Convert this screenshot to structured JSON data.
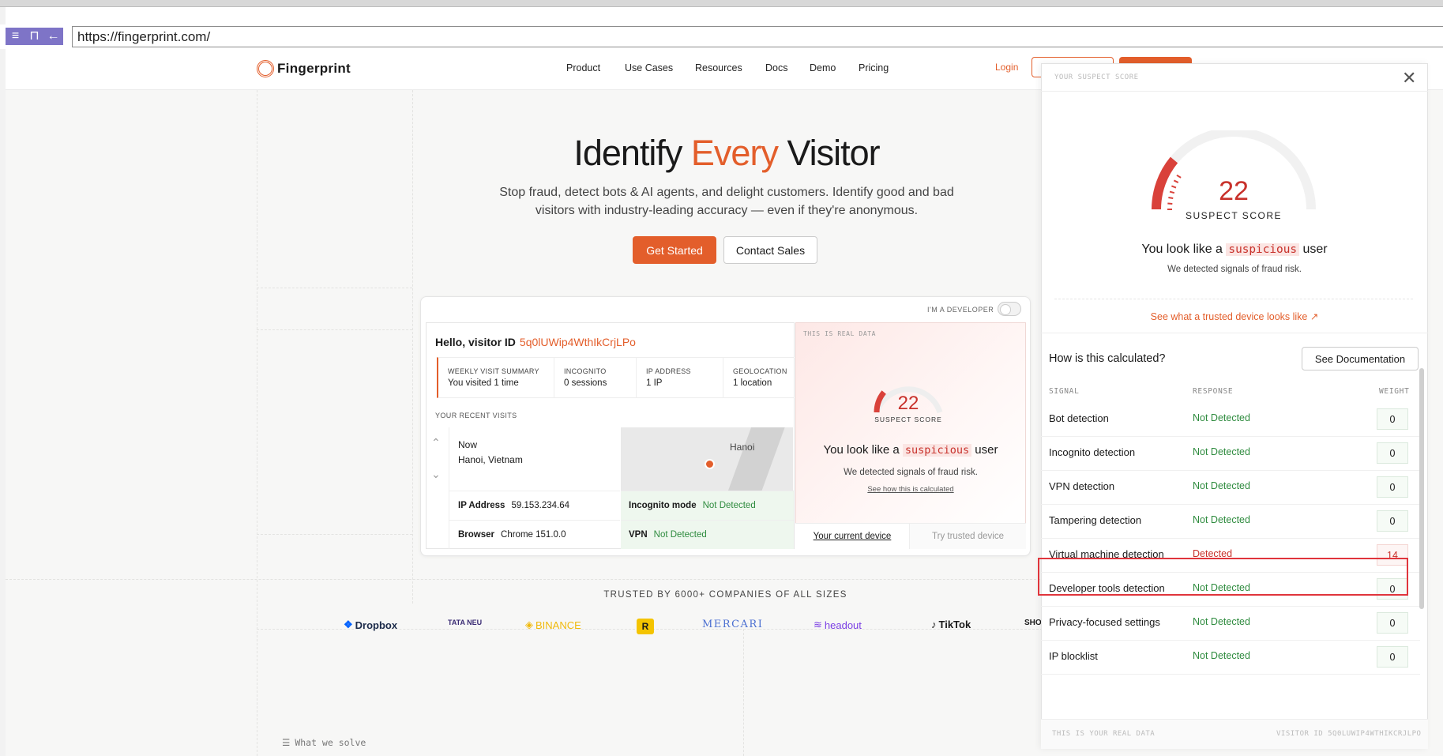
{
  "browser": {
    "url": "https://fingerprint.com/",
    "icons": [
      "menu-icon",
      "window-icon",
      "back-arrow-icon"
    ]
  },
  "header": {
    "brand": "Fingerprint",
    "nav": [
      "Product",
      "Use Cases",
      "Resources",
      "Docs",
      "Demo",
      "Pricing"
    ],
    "login": "Login"
  },
  "hero": {
    "title_1": "Identify ",
    "title_accent": "Every",
    "title_2": " Visitor",
    "subtitle_1": "Stop fraud, detect bots & AI agents, and delight customers. Identify good and bad",
    "subtitle_2": "visitors with industry-leading accuracy — even if they're anonymous.",
    "cta_primary": "Get Started",
    "cta_secondary": "Contact Sales"
  },
  "demo": {
    "developer_label": "I'M A DEVELOPER",
    "hello_label": "Hello, visitor ID",
    "visitor_id": "5q0lUWip4WthIkCrjLPo",
    "stats": [
      {
        "label": "WEEKLY VISIT SUMMARY",
        "value": "You visited 1 time"
      },
      {
        "label": "INCOGNITO",
        "value": "0 sessions"
      },
      {
        "label": "IP ADDRESS",
        "value": "1 IP"
      },
      {
        "label": "GEOLOCATION",
        "value": "1 location"
      }
    ],
    "recent_label": "YOUR RECENT VISITS",
    "visit_time": "Now",
    "visit_location": "Hanoi, Vietnam",
    "map_city": "Hanoi",
    "ip_label": "IP Address",
    "ip_value": "59.153.234.64",
    "browser_label": "Browser",
    "browser_value": "Chrome 151.0.0",
    "incognito_label": "Incognito mode",
    "incognito_value": "Not Detected",
    "vpn_label": "VPN",
    "vpn_value": "Not Detected",
    "real_data_label": "THIS IS REAL DATA",
    "score": "22",
    "score_label": "SUSPECT SCORE",
    "look_pre": "You look like a ",
    "look_word": "suspicious",
    "look_post": " user",
    "detect_text": "We detected signals of fraud risk.",
    "calc_link": "See how this is calculated",
    "tab_current": "Your current device",
    "tab_trusted": "Try trusted device"
  },
  "trusted": {
    "heading": "TRUSTED BY 6000+ COMPANIES OF ALL SIZES",
    "logos": [
      "Dropbox",
      "TATA NEU",
      "BINANCE",
      "R",
      "MERCARI",
      "headout",
      "TikTok",
      "SHOPBACK"
    ]
  },
  "solve_label": "What we solve",
  "panel": {
    "top_label": "YOUR SUSPECT SCORE",
    "score": "22",
    "score_label": "SUSPECT SCORE",
    "score_fraction": 0.22,
    "look_pre": "You look like a ",
    "look_word": "suspicious",
    "look_post": " user",
    "detect_text": "We detected signals of fraud risk.",
    "trusted_link": "See what a trusted device looks like ↗",
    "how_title": "How is this calculated?",
    "docs_button": "See Documentation",
    "col_signal": "SIGNAL",
    "col_response": "RESPONSE",
    "col_weight": "WEIGHT",
    "signals": [
      {
        "name": "Bot detection",
        "response": "Not Detected",
        "weight": "0"
      },
      {
        "name": "Incognito detection",
        "response": "Not Detected",
        "weight": "0"
      },
      {
        "name": "VPN detection",
        "response": "Not Detected",
        "weight": "0"
      },
      {
        "name": "Tampering detection",
        "response": "Not Detected",
        "weight": "0"
      },
      {
        "name": "Virtual machine detection",
        "response": "Detected",
        "weight": "14"
      },
      {
        "name": "Developer tools detection",
        "response": "Not Detected",
        "weight": "0"
      },
      {
        "name": "Privacy-focused settings",
        "response": "Not Detected",
        "weight": "0"
      },
      {
        "name": "IP blocklist",
        "response": "Not Detected",
        "weight": "0"
      }
    ],
    "footer_left": "THIS IS YOUR REAL DATA",
    "footer_right": "VISITOR ID 5Q0LUWIP4WTHIKCRJLPO"
  },
  "colors": {
    "accent": "#e35e2b",
    "danger": "#c8312b",
    "ok": "#2e8b3e",
    "highlight": "#e0353c",
    "browser_button": "#7e74c7"
  }
}
